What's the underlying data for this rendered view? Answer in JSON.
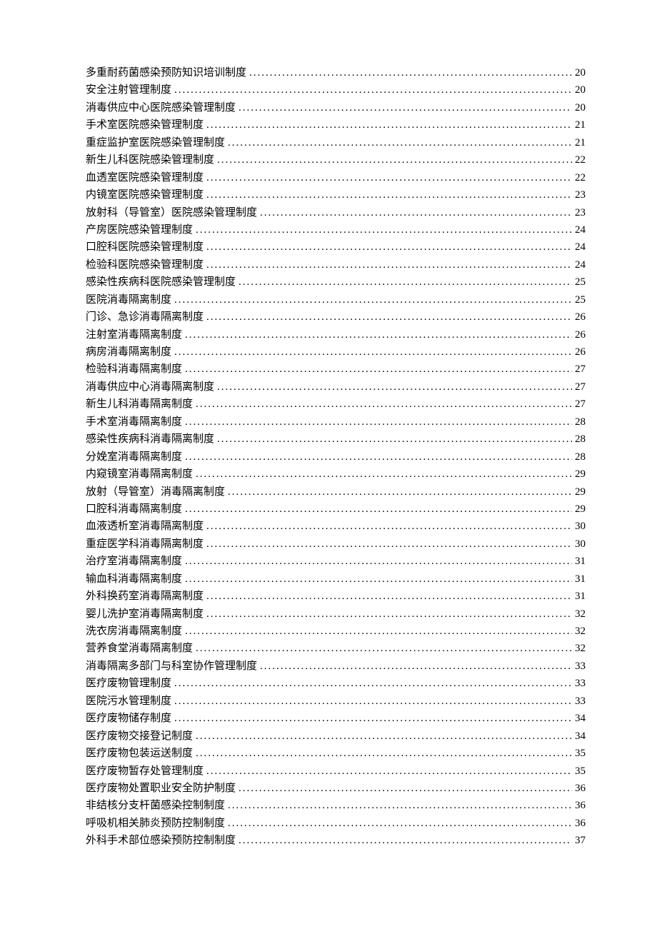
{
  "toc": [
    {
      "title": "多重耐药菌感染预防知识培训制度",
      "page": "20"
    },
    {
      "title": "安全注射管理制度",
      "page": "20"
    },
    {
      "title": "消毒供应中心医院感染管理制度",
      "page": "20"
    },
    {
      "title": "手术室医院感染管理制度",
      "page": "21"
    },
    {
      "title": "重症监护室医院感染管理制度",
      "page": "21"
    },
    {
      "title": "新生儿科医院感染管理制度",
      "page": "22"
    },
    {
      "title": "血透室医院感染管理制度",
      "page": "22"
    },
    {
      "title": "内镜室医院感染管理制度",
      "page": "23"
    },
    {
      "title": "放射科（导管室）医院感染管理制度",
      "page": "23"
    },
    {
      "title": "产房医院感染管理制度",
      "page": "24"
    },
    {
      "title": "口腔科医院感染管理制度",
      "page": "24"
    },
    {
      "title": "检验科医院感染管理制度",
      "page": "24"
    },
    {
      "title": "感染性疾病科医院感染管理制度",
      "page": "25"
    },
    {
      "title": "医院消毒隔离制度",
      "page": "25"
    },
    {
      "title": "门诊、急诊消毒隔离制度",
      "page": "26"
    },
    {
      "title": "注射室消毒隔离制度",
      "page": "26"
    },
    {
      "title": "病房消毒隔离制度",
      "page": "26"
    },
    {
      "title": "检验科消毒隔离制度",
      "page": "27"
    },
    {
      "title": "消毒供应中心消毒隔离制度",
      "page": "27"
    },
    {
      "title": "新生儿科消毒隔离制度",
      "page": "27"
    },
    {
      "title": "手术室消毒隔离制度",
      "page": "28"
    },
    {
      "title": "感染性疾病科消毒隔离制度",
      "page": "28"
    },
    {
      "title": "分娩室消毒隔离制度",
      "page": "28"
    },
    {
      "title": "内窥镜室消毒隔离制度",
      "page": "29"
    },
    {
      "title": "放射（导管室）消毒隔离制度",
      "page": "29"
    },
    {
      "title": "口腔科消毒隔离制度",
      "page": "29"
    },
    {
      "title": "血液透析室消毒隔离制度",
      "page": "30"
    },
    {
      "title": "重症医学科消毒隔离制度",
      "page": "30"
    },
    {
      "title": "治疗室消毒隔离制度",
      "page": "31"
    },
    {
      "title": "输血科消毒隔离制度",
      "page": "31"
    },
    {
      "title": "外科换药室消毒隔离制度",
      "page": "31"
    },
    {
      "title": "婴儿洗护室消毒隔离制度",
      "page": "32"
    },
    {
      "title": "洗衣房消毒隔离制度",
      "page": "32"
    },
    {
      "title": "营养食堂消毒隔离制度",
      "page": "32"
    },
    {
      "title": "消毒隔离多部门与科室协作管理制度",
      "page": "33"
    },
    {
      "title": "医疗废物管理制度",
      "page": "33"
    },
    {
      "title": "医院污水管理制度",
      "page": "33"
    },
    {
      "title": "医疗废物储存制度",
      "page": "34"
    },
    {
      "title": "医疗废物交接登记制度",
      "page": "34"
    },
    {
      "title": "医疗废物包装运送制度",
      "page": "35"
    },
    {
      "title": "医疗废物暂存处管理制度",
      "page": "35"
    },
    {
      "title": "医疗废物处置职业安全防护制度",
      "page": "36"
    },
    {
      "title": "非结核分支杆菌感染控制制度",
      "page": "36"
    },
    {
      "title": "呼吸机相关肺炎预防控制制度",
      "page": "36"
    },
    {
      "title": "外科手术部位感染预防控制制度",
      "page": "37"
    }
  ]
}
